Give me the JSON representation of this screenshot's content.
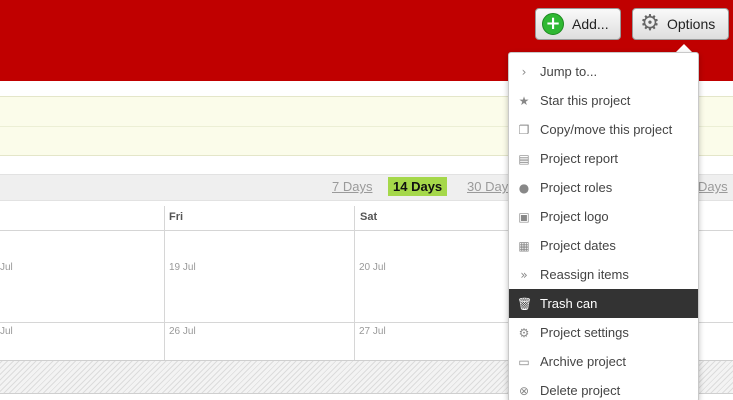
{
  "header": {
    "add_label": "Add...",
    "options_label": "Options",
    "add_icon": "plus-circle-icon",
    "options_icon": "gear-icon",
    "brand_color": "#c00000"
  },
  "range": {
    "items": [
      "7 Days",
      "14 Days",
      "30 Days",
      "Days"
    ],
    "selected": "14 Days",
    "selected_color": "#a5d84a"
  },
  "calendar": {
    "days": [
      "Fri",
      "Sat"
    ],
    "week1": [
      "Jul",
      "19 Jul",
      "20 Jul"
    ],
    "week2": [
      "Jul",
      "26 Jul",
      "27 Jul"
    ]
  },
  "options_menu": {
    "items": [
      {
        "label": "Jump to...",
        "icon": "chevron-right-icon"
      },
      {
        "label": "Star this project",
        "icon": "star-icon"
      },
      {
        "label": "Copy/move this project",
        "icon": "copy-icon"
      },
      {
        "label": "Project report",
        "icon": "bar-chart-icon"
      },
      {
        "label": "Project roles",
        "icon": "people-icon"
      },
      {
        "label": "Project logo",
        "icon": "image-icon"
      },
      {
        "label": "Project dates",
        "icon": "calendar-icon"
      },
      {
        "label": "Reassign items",
        "icon": "double-chevron-icon"
      },
      {
        "label": "Trash can",
        "icon": "trash-icon",
        "active": true
      },
      {
        "label": "Project settings",
        "icon": "gear-icon"
      },
      {
        "label": "Archive project",
        "icon": "folder-icon"
      },
      {
        "label": "Delete project",
        "icon": "delete-icon"
      }
    ]
  }
}
